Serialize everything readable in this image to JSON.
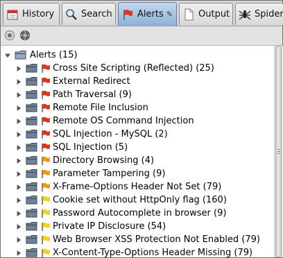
{
  "tabs": [
    {
      "label": "History",
      "icon": "history-icon",
      "active": false
    },
    {
      "label": "Search",
      "icon": "search-icon",
      "active": false
    },
    {
      "label": "Alerts",
      "icon": "alerts-flag-icon",
      "active": true,
      "pinned": true
    },
    {
      "label": "Output",
      "icon": "output-document-icon",
      "active": false
    },
    {
      "label": "Spider",
      "icon": "spider-icon",
      "active": false
    }
  ],
  "toolbar": {
    "buttons": [
      {
        "icon": "filter-icon"
      },
      {
        "icon": "scan-settings-icon"
      }
    ]
  },
  "tree": {
    "root_label": "Alerts (15)",
    "items": [
      {
        "label": "Cross Site Scripting (Reflected) (25)",
        "risk": "high"
      },
      {
        "label": "External Redirect",
        "risk": "high"
      },
      {
        "label": "Path Traversal (9)",
        "risk": "high"
      },
      {
        "label": "Remote File Inclusion",
        "risk": "high"
      },
      {
        "label": "Remote OS Command Injection",
        "risk": "high"
      },
      {
        "label": "SQL Injection - MySQL (2)",
        "risk": "high"
      },
      {
        "label": "SQL Injection (5)",
        "risk": "high"
      },
      {
        "label": "Directory Browsing (4)",
        "risk": "medium"
      },
      {
        "label": "Parameter Tampering (9)",
        "risk": "medium"
      },
      {
        "label": "X-Frame-Options Header Not Set (79)",
        "risk": "medium"
      },
      {
        "label": "Cookie set without HttpOnly flag (160)",
        "risk": "low"
      },
      {
        "label": "Password Autocomplete in browser (9)",
        "risk": "low"
      },
      {
        "label": "Private IP Disclosure (54)",
        "risk": "low"
      },
      {
        "label": "Web Browser XSS Protection Not Enabled (79)",
        "risk": "low"
      },
      {
        "label": "X-Content-Type-Options Header Missing (79)",
        "risk": "low"
      }
    ]
  },
  "colors": {
    "high": "#e0341c",
    "medium": "#f09a18",
    "low": "#f2d21a",
    "folder": "#6f8196",
    "active_tab": "#8fb1d6"
  }
}
